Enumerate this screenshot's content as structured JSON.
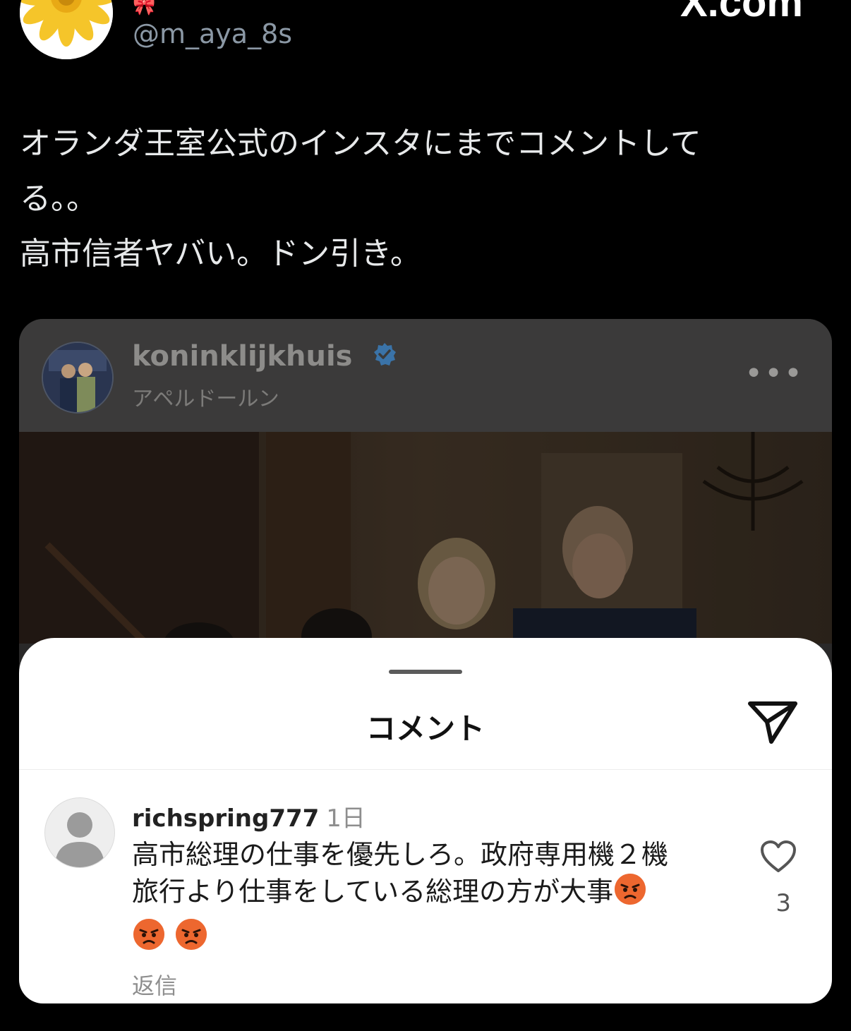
{
  "tweet": {
    "handle": "@m_aya_8s",
    "header_emoji": "🎀",
    "site_label": "X.com",
    "text_lines": [
      "オランダ王室公式のインスタにまでコメントして",
      "る。。",
      "高市信者ヤバい。ドン引き。"
    ]
  },
  "instagram_post": {
    "username": "koninklijkhuis",
    "location": "アペルドールン",
    "more_label": "•••",
    "icons": {
      "verified": "verified-badge-icon",
      "more": "more-options-icon"
    }
  },
  "comments_sheet": {
    "title": "コメント",
    "comment": {
      "username": "richspring777",
      "time": "1日",
      "body_lines": [
        "高市総理の仕事を優先しろ。政府専用機２機",
        "旅行より仕事をしている総理の方が大事"
      ],
      "reply_label": "返信",
      "like_count": "3"
    },
    "icons": {
      "send": "send-icon",
      "like": "heart-icon",
      "avatar": "default-avatar-icon",
      "emoji": "angry-face-emoji"
    }
  },
  "colors": {
    "background": "#000000",
    "tweet_text": "#e7e9ea",
    "handle": "#8b98a5",
    "verified": "#3b82c4",
    "sheet": "#ffffff"
  }
}
